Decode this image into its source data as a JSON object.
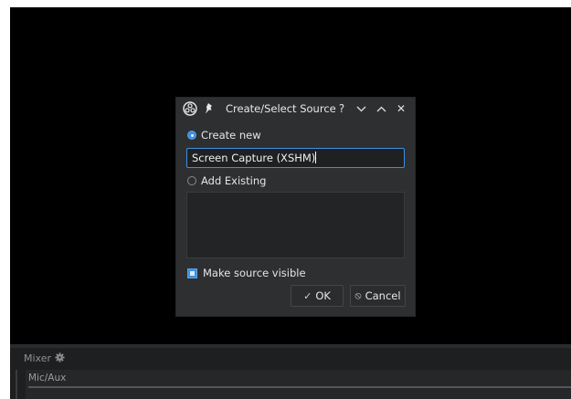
{
  "dialog": {
    "title": "Create/Select Source",
    "icons": {
      "app": "obs-logo-icon",
      "pin": "pin-icon",
      "help": "help-icon",
      "minimize": "chevron-down-icon",
      "maximize": "chevron-up-icon",
      "close": "close-icon"
    },
    "title_buttons": {
      "help": "?",
      "close": "✕"
    },
    "create_new_label": "Create new",
    "create_new_selected": true,
    "source_name": "Screen Capture (XSHM)",
    "add_existing_label": "Add Existing",
    "add_existing_selected": false,
    "existing_sources": [],
    "make_visible_label": "Make source visible",
    "make_visible_checked": true,
    "ok_label": "OK",
    "cancel_label": "Cancel",
    "ok_glyph": "✓",
    "cancel_glyph": "⦸"
  },
  "mixer": {
    "title": "Mixer",
    "settings_icon": "gear-icon",
    "channel_label": "Mic/Aux"
  },
  "colors": {
    "accent": "#3d8fe0",
    "dialog_bg": "#2e2f31",
    "screen_bg": "#000000"
  }
}
